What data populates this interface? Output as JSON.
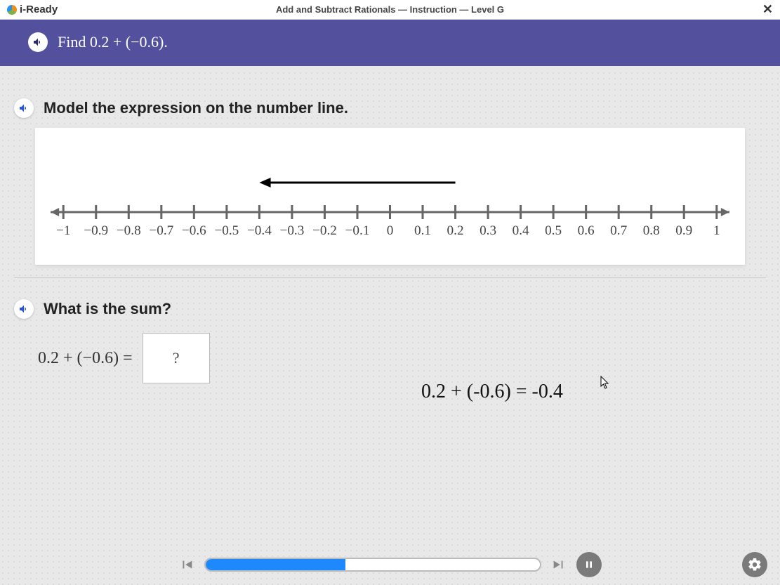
{
  "header": {
    "brand": "i-Ready",
    "lesson_title": "Add and Subtract Rationals — Instruction — Level G",
    "close_label": "✕"
  },
  "prompt": {
    "text_prefix": "Find ",
    "expression": "0.2 + (−0.6).",
    "full": "Find 0.2 + (−0.6)."
  },
  "section1": {
    "heading": "Model the expression on the number line."
  },
  "number_line": {
    "min": -1,
    "max": 1,
    "step": 0.1,
    "labels": [
      "−1",
      "−0.9",
      "−0.8",
      "−0.7",
      "−0.6",
      "−0.5",
      "−0.4",
      "−0.3",
      "−0.2",
      "−0.1",
      "0",
      "0.1",
      "0.2",
      "0.3",
      "0.4",
      "0.5",
      "0.6",
      "0.7",
      "0.8",
      "0.9",
      "1"
    ],
    "arrow_from": 0.2,
    "arrow_to": -0.4
  },
  "section2": {
    "heading": "What is the sum?",
    "equation_lhs": "0.2 + (−0.6) =",
    "placeholder": "?"
  },
  "solution": {
    "text": "0.2 + (-0.6) = -0.4"
  },
  "footer": {
    "progress_pct": 42
  },
  "colors": {
    "purple": "#53509e",
    "blue": "#1e88ff"
  }
}
